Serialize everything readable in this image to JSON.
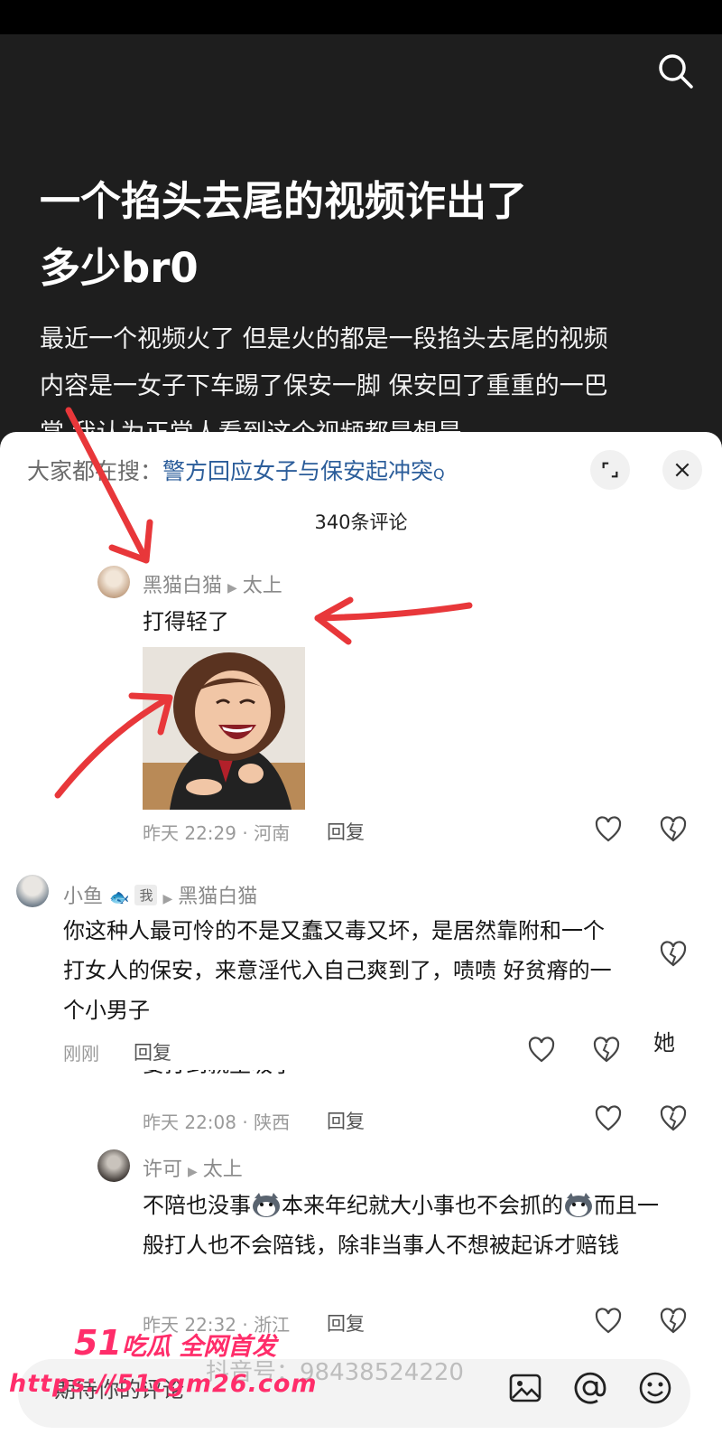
{
  "article": {
    "title_line1": "一个掐头去尾的视频诈出了",
    "title_line2": "多少br0",
    "body": "最近一个视频火了 但是火的都是一段掐头去尾的视频 内容是一女子下车踢了保安一脚 保安回了重重的一巴掌 我认为正常人看到这个视频都是想是"
  },
  "sheet": {
    "hot_prefix": "大家都在搜：",
    "hot_query": "警方回应女子与保安起冲突",
    "comment_count": "340条评论"
  },
  "comments": [
    {
      "user": "黑猫白猫",
      "reply_to": "太上",
      "text": "打得轻了",
      "meta": "昨天 22:29 · 河南",
      "reply_label": "回复"
    },
    {
      "user": "小鱼",
      "badge": "我",
      "reply_to": "黑猫白猫",
      "text": "你这种人最可怜的不是又蠢又毒又坏，是居然靠附和一个打女人的保安，来意淫代入自己爽到了，啧啧 好贫瘠的一个小男子",
      "meta": "刚刚",
      "reply_label": "回复"
    },
    {
      "partial_text": "要打到就生吸了",
      "meta": "昨天 22:08 · 陕西",
      "reply_label": "回复"
    },
    {
      "user": "许可",
      "reply_to": "太上",
      "text_part1": "不陪也没事",
      "text_part2": "本来年纪就大小事也不会抓的",
      "text_part3": "而且一般打人也不会陪钱，除非当事人不想被起诉才赔钱",
      "meta": "昨天 22:32 · 浙江",
      "reply_label": "回复"
    }
  ],
  "floating_text": "她",
  "input": {
    "placeholder": "期待你的评论",
    "douyin_watermark": "抖音号：98438524220"
  },
  "watermark": {
    "title_num": "51",
    "title_text": "吃瓜 全网首发",
    "url": "https://51cgm26.com"
  },
  "colors": {
    "arrow": "#e8373a",
    "link": "#2b5d9a",
    "watermark": "#ff2d6a"
  }
}
